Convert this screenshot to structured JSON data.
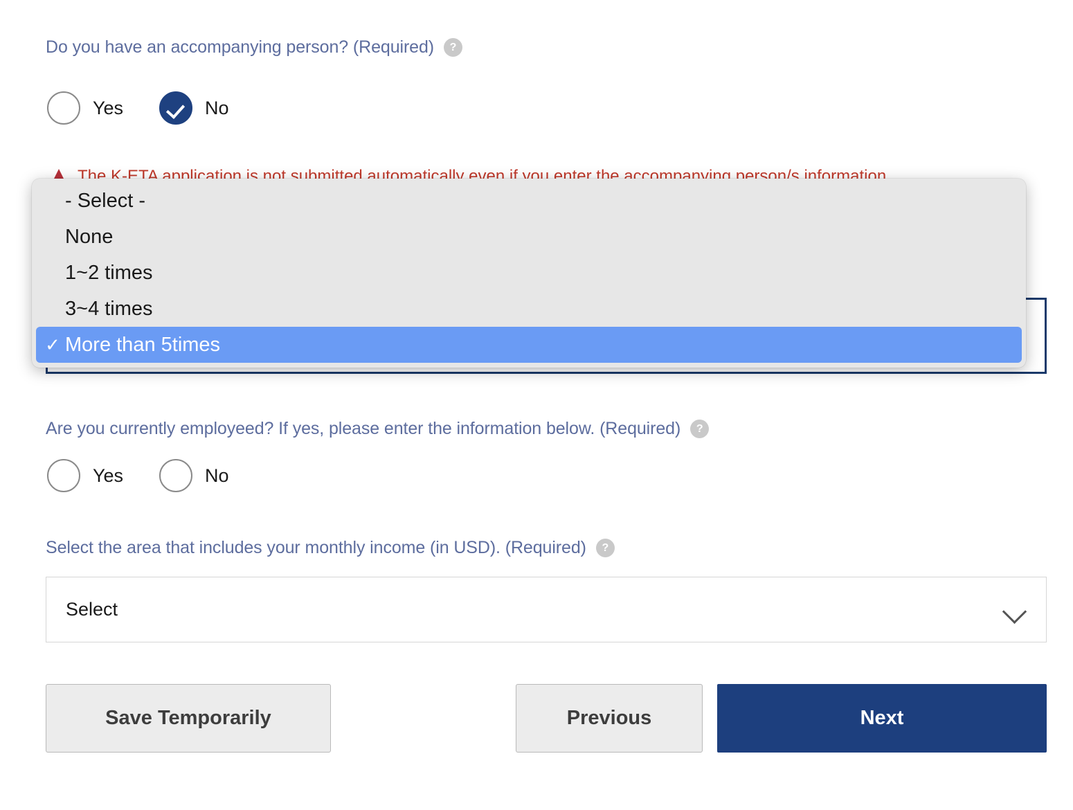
{
  "questions": {
    "accompanying_person": {
      "label": "Do you have an accompanying person? (Required)",
      "help_icon": "question-mark-icon",
      "options": [
        {
          "label": "Yes",
          "checked": false
        },
        {
          "label": "No",
          "checked": true
        }
      ]
    },
    "employment": {
      "label": "Are you currently employeed? If yes, please enter the information below. (Required)",
      "help_icon": "question-mark-icon",
      "options": [
        {
          "label": "Yes",
          "checked": false
        },
        {
          "label": "No",
          "checked": false
        }
      ]
    },
    "monthly_income": {
      "label": "Select the area that includes your monthly income (in USD). (Required)",
      "help_icon": "question-mark-icon",
      "select_value": "Select",
      "chevron_icon": "chevron-down-icon"
    }
  },
  "warning": {
    "icon": "warning-triangle-icon",
    "text": "The K-ETA application is not submitted automatically even if you enter the accompanying person/s information."
  },
  "open_dropdown": {
    "options": [
      {
        "label": "- Select -",
        "selected": false
      },
      {
        "label": "None",
        "selected": false
      },
      {
        "label": "1~2 times",
        "selected": false
      },
      {
        "label": "3~4 times",
        "selected": false
      },
      {
        "label": "More than 5times",
        "selected": true
      }
    ],
    "check_glyph": "✓"
  },
  "buttons": {
    "save_temporarily": "Save Temporarily",
    "previous": "Previous",
    "next": "Next"
  },
  "colors": {
    "label_blue": "#5d6d9e",
    "primary_navy": "#1d3f7e",
    "highlight_blue": "#6a9bf4",
    "warning_red": "#c0392b",
    "dropdown_bg": "#e7e7e7"
  }
}
